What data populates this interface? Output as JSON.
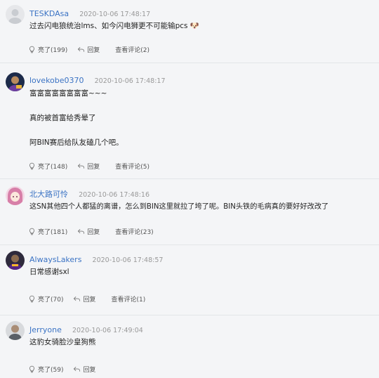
{
  "comments": [
    {
      "username": "TESKDAsa",
      "time": "2020-10-06 17:48:17",
      "lines": [
        "过去闪电狼统治lms、如今闪电狮更不可能输pcs 🐶"
      ],
      "like_label": "亮了(199)",
      "reply_label": "回复",
      "view_label": "查看评论(2)",
      "avatar": "default-avatar"
    },
    {
      "username": "lovekobe0370",
      "time": "2020-10-06 17:48:17",
      "lines": [
        "富富富富富富富富~~~",
        "真的被首富给秀晕了",
        "阿BIN赛后给队友磕几个吧。"
      ],
      "like_label": "亮了(148)",
      "reply_label": "回复",
      "view_label": "查看评论(5)",
      "avatar": "player-avatar"
    },
    {
      "username": "北大路可怜",
      "time": "2020-10-06 17:48:16",
      "lines": [
        "这SN其他四个人都猛的离谱，怎么到BIN这里就拉了垮了呢。BIN头铁的毛病真的要好好改改了"
      ],
      "like_label": "亮了(181)",
      "reply_label": "回复",
      "view_label": "查看评论(23)",
      "avatar": "anime-avatar"
    },
    {
      "username": "AlwaysLakers",
      "time": "2020-10-06 17:48:57",
      "lines": [
        "日常感谢sxl"
      ],
      "like_label": "亮了(70)",
      "reply_label": "回复",
      "view_label": "查看评论(1)",
      "avatar": "lakers-avatar"
    },
    {
      "username": "Jerryone",
      "time": "2020-10-06 17:49:04",
      "lines": [
        "这豹女骑脸沙皇狗熊"
      ],
      "like_label": "亮了(59)",
      "reply_label": "回复",
      "view_label": "",
      "avatar": "person-avatar"
    }
  ],
  "colors": {
    "background": "#f4f5f7",
    "username": "#3b73c4",
    "timestamp": "#999999",
    "divider": "#e3e5e8"
  },
  "icons": {
    "like": "lightbulb-icon",
    "reply": "reply-arrow-icon"
  }
}
